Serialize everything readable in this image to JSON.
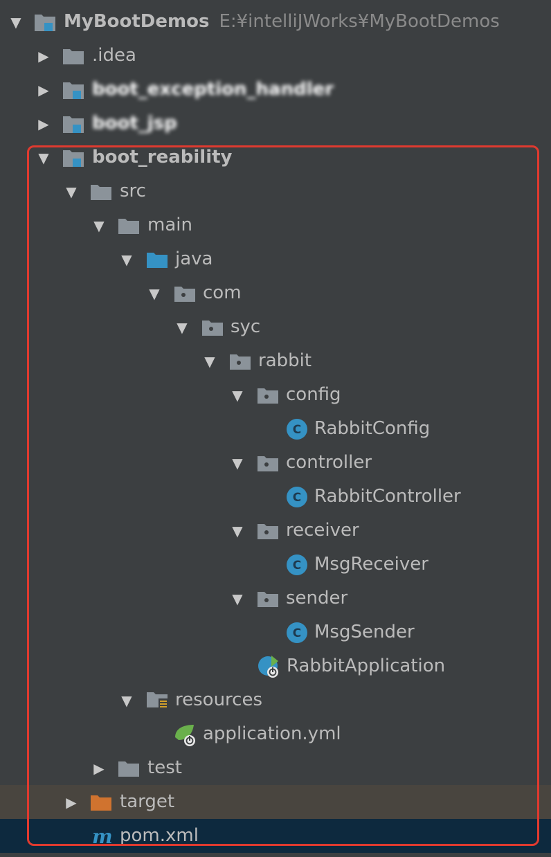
{
  "tree": {
    "root": {
      "label": "MyBootDemos",
      "path": "E:¥intelliJWorks¥MyBootDemos"
    },
    "idea": {
      "label": ".idea"
    },
    "blurred1": {
      "label": "boot_exception_handler"
    },
    "blurred2": {
      "label": "boot_jsp"
    },
    "module": {
      "label": "boot_reability"
    },
    "src": {
      "label": "src"
    },
    "main": {
      "label": "main"
    },
    "java": {
      "label": "java"
    },
    "com": {
      "label": "com"
    },
    "syc": {
      "label": "syc"
    },
    "rabbit": {
      "label": "rabbit"
    },
    "config": {
      "label": "config"
    },
    "rabbit_config": {
      "label": "RabbitConfig"
    },
    "controller": {
      "label": "controller"
    },
    "rabbit_controller": {
      "label": "RabbitController"
    },
    "receiver": {
      "label": "receiver"
    },
    "msg_receiver": {
      "label": "MsgReceiver"
    },
    "sender": {
      "label": "sender"
    },
    "msg_sender": {
      "label": "MsgSender"
    },
    "rabbit_application": {
      "label": "RabbitApplication"
    },
    "resources": {
      "label": "resources"
    },
    "application_yml": {
      "label": "application.yml"
    },
    "test": {
      "label": "test"
    },
    "target": {
      "label": "target"
    },
    "pom": {
      "label": "pom.xml"
    }
  },
  "colors": {
    "background": "#3c3f41",
    "folder": "#8b939a",
    "source_folder": "#3592c4",
    "class_icon": "#3592c4",
    "excluded_folder": "#d0732f",
    "highlight_border": "#e03a2f",
    "selected_row": "#0d293e"
  },
  "icons": {
    "expanded": "triangle-down-icon",
    "collapsed": "triangle-right-icon",
    "folder": "folder-icon",
    "package": "package-icon",
    "class": "class-icon",
    "spring_boot": "spring-boot-icon",
    "maven": "maven-icon"
  }
}
